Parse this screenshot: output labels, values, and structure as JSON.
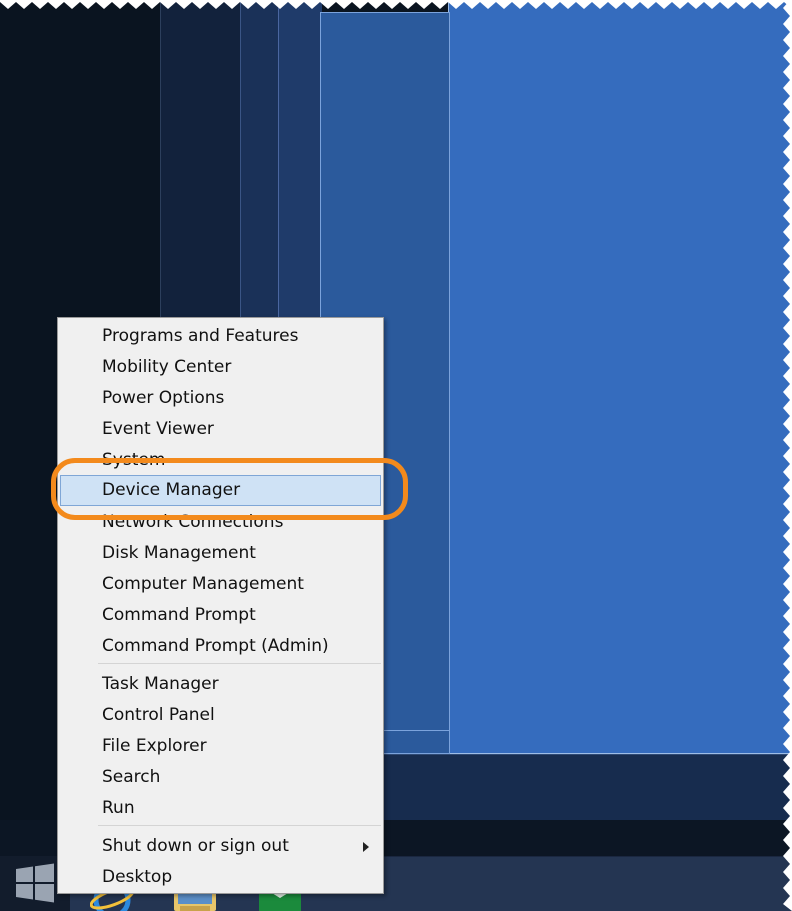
{
  "context_menu": {
    "group_1": [
      {
        "label": "Programs and Features"
      },
      {
        "label": "Mobility Center"
      },
      {
        "label": "Power Options"
      },
      {
        "label": "Event Viewer"
      },
      {
        "label": "System"
      },
      {
        "label": "Device Manager",
        "highlighted": true
      },
      {
        "label": "Network Connections"
      },
      {
        "label": "Disk Management"
      },
      {
        "label": "Computer Management"
      },
      {
        "label": "Command Prompt"
      },
      {
        "label": "Command Prompt (Admin)"
      }
    ],
    "group_2": [
      {
        "label": "Task Manager"
      },
      {
        "label": "Control Panel"
      },
      {
        "label": "File Explorer"
      },
      {
        "label": "Search"
      },
      {
        "label": "Run"
      }
    ],
    "group_3": [
      {
        "label": "Shut down or sign out",
        "has_submenu": true
      },
      {
        "label": "Desktop"
      }
    ]
  },
  "colors": {
    "menu_background": "#f0f0f0",
    "highlight_background": "#cfe2f5",
    "highlight_border": "#7fa6d6",
    "callout_orange": "#f38a1c",
    "desktop_blue": "#356cbe"
  },
  "icons": {
    "start": "windows-logo-icon",
    "taskbar_apps": [
      "internet-explorer-icon",
      "file-explorer-icon",
      "store-icon"
    ]
  }
}
